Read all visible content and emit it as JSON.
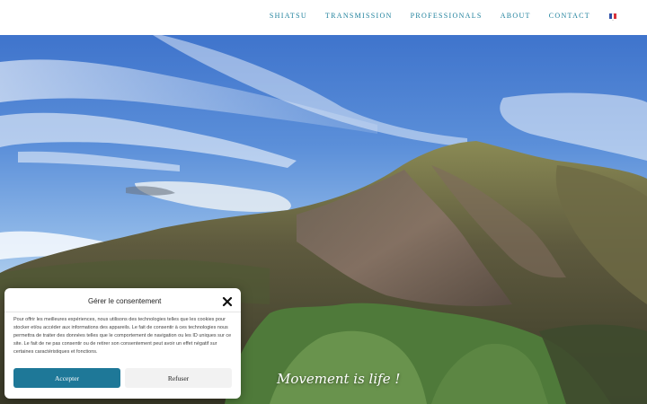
{
  "nav": {
    "items": [
      {
        "label": "SHIATSU"
      },
      {
        "label": "TRANSMISSION"
      },
      {
        "label": "PROFESSIONALS"
      },
      {
        "label": "ABOUT"
      },
      {
        "label": "CONTACT"
      }
    ],
    "language_flag_icon": "french-flag-icon"
  },
  "hero": {
    "slogan": "Movement is life !"
  },
  "consent": {
    "title": "Gérer le consentement",
    "close_icon": "close-icon",
    "text": "Pour offrir les meilleures expériences, nous utilisons des technologies telles que les cookies pour stocker et/ou accéder aux informations des appareils. Le fait de consentir à ces technologies nous permettra de traiter des données telles que le comportement de navigation ou les ID uniques sur ce site. Le fait de ne pas consentir ou de retirer son consentement peut avoir un effet négatif sur certaines caractéristiques et fonctions.",
    "accept_label": "Accepter",
    "refuse_label": "Refuser"
  },
  "colors": {
    "accent": "#1e7898",
    "nav_text": "#1c7f9b"
  }
}
